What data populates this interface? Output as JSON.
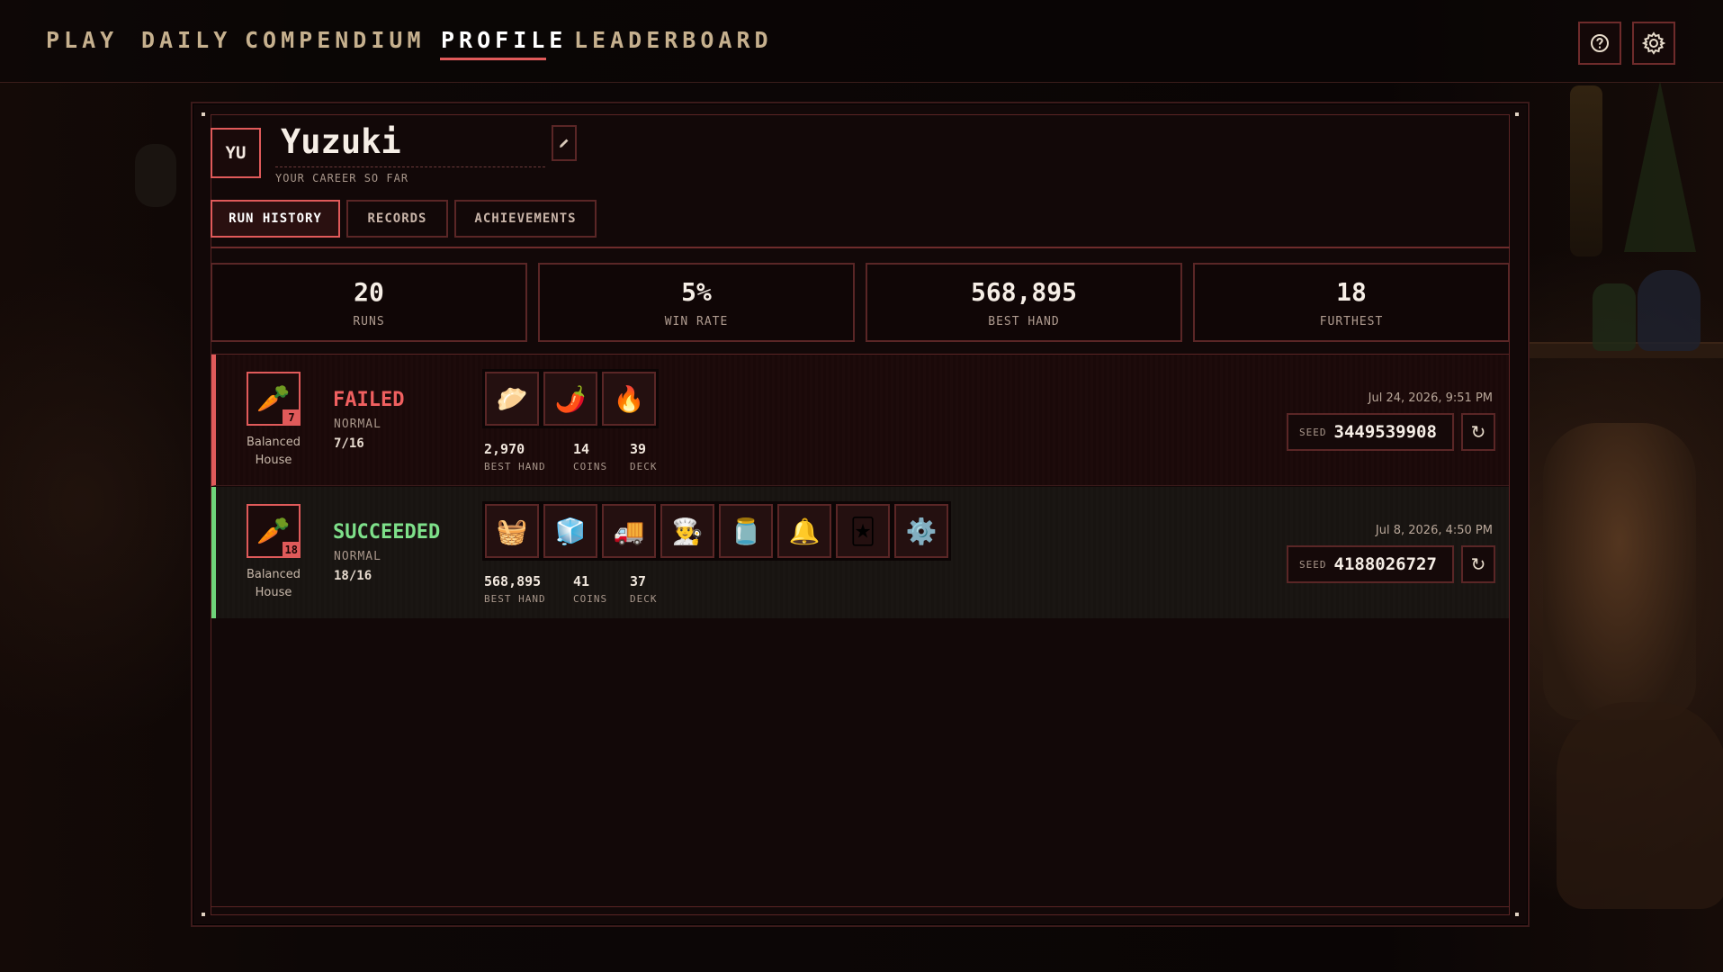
{
  "nav": {
    "tabs": [
      {
        "label": "PLAY"
      },
      {
        "label": "DAILY"
      },
      {
        "label": "COMPENDIUM"
      },
      {
        "label": "PROFILE"
      },
      {
        "label": "LEADERBOARD"
      }
    ],
    "active": "PROFILE",
    "icons": [
      "help-icon",
      "gear-icon"
    ]
  },
  "profile": {
    "initials": "YU",
    "name": "Yuzuki",
    "subtitle": "YOUR CAREER SO FAR",
    "tabs": [
      {
        "label": "RUN HISTORY"
      },
      {
        "label": "RECORDS"
      },
      {
        "label": "ACHIEVEMENTS"
      }
    ],
    "active_tab": "RUN HISTORY"
  },
  "stats": [
    {
      "value": "20",
      "label": "RUNS"
    },
    {
      "value": "5%",
      "label": "WIN RATE"
    },
    {
      "value": "568,895",
      "label": "BEST HAND"
    },
    {
      "value": "18",
      "label": "FURTHEST"
    }
  ],
  "runs": [
    {
      "deck_icon": "carrot-icon",
      "deck_badge": "7",
      "deck_name_1": "Balanced",
      "deck_name_2": "House",
      "status": "FAILED",
      "mode": "NORMAL",
      "progress": "7/16",
      "items": [
        "nachos-icon",
        "bottle-icon",
        "flame-helmet-icon"
      ],
      "best_hand": "2,970",
      "best_hand_label": "BEST HAND",
      "coins": "14",
      "coins_label": "COINS",
      "deck": "39",
      "deck_label": "DECK",
      "date": "Jul 24, 2026, 9:51 PM",
      "seed_label": "SEED",
      "seed": "3449539908",
      "status_color": "#f06060"
    },
    {
      "deck_icon": "carrot-icon",
      "deck_badge": "18",
      "deck_name_1": "Balanced",
      "deck_name_2": "House",
      "status": "SUCCEEDED",
      "mode": "NORMAL",
      "progress": "18/16",
      "items": [
        "basket-icon",
        "fridge-icon",
        "food-truck-icon",
        "chef-hat-icon",
        "tips-jar-icon",
        "bell-icon",
        "card-icon",
        "grinder-icon"
      ],
      "best_hand": "568,895",
      "best_hand_label": "BEST HAND",
      "coins": "41",
      "coins_label": "COINS",
      "deck": "37",
      "deck_label": "DECK",
      "date": "Jul 8, 2026, 4:50 PM",
      "seed_label": "SEED",
      "seed": "4188026727",
      "status_color": "#7ee08a"
    }
  ],
  "colors": {
    "accent": "#e05a5a",
    "success": "#6fd57a",
    "nav_text": "#c6b08e"
  }
}
